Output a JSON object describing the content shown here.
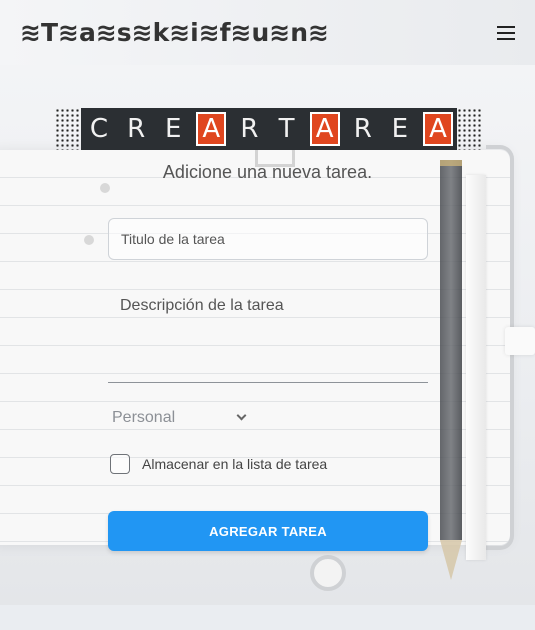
{
  "navbar": {
    "brand": "≋T≋a≋s≋k≋i≋f≋u≋n≋",
    "menu_icon": "hamburger-menu-icon"
  },
  "banner": {
    "letters": [
      {
        "char": "C",
        "highlight": false
      },
      {
        "char": "R",
        "highlight": false
      },
      {
        "char": "E",
        "highlight": false
      },
      {
        "char": "A",
        "highlight": true
      },
      {
        "char": "R",
        "highlight": false
      },
      {
        "char": "T",
        "highlight": false
      },
      {
        "char": "A",
        "highlight": true
      },
      {
        "char": "R",
        "highlight": false
      },
      {
        "char": "E",
        "highlight": false
      },
      {
        "char": "A",
        "highlight": true
      }
    ],
    "highlight_color": "#e0461f"
  },
  "form": {
    "subtitle": "Adicione una nueva tarea.",
    "title_placeholder": "Titulo de la tarea",
    "description_placeholder": "Descripción de la tarea",
    "category_selected": "Personal",
    "store_label": "Almacenar en la lista de tarea",
    "store_checked": false,
    "submit_label": "AGREGAR TAREA",
    "accent_color": "#2196f3"
  }
}
